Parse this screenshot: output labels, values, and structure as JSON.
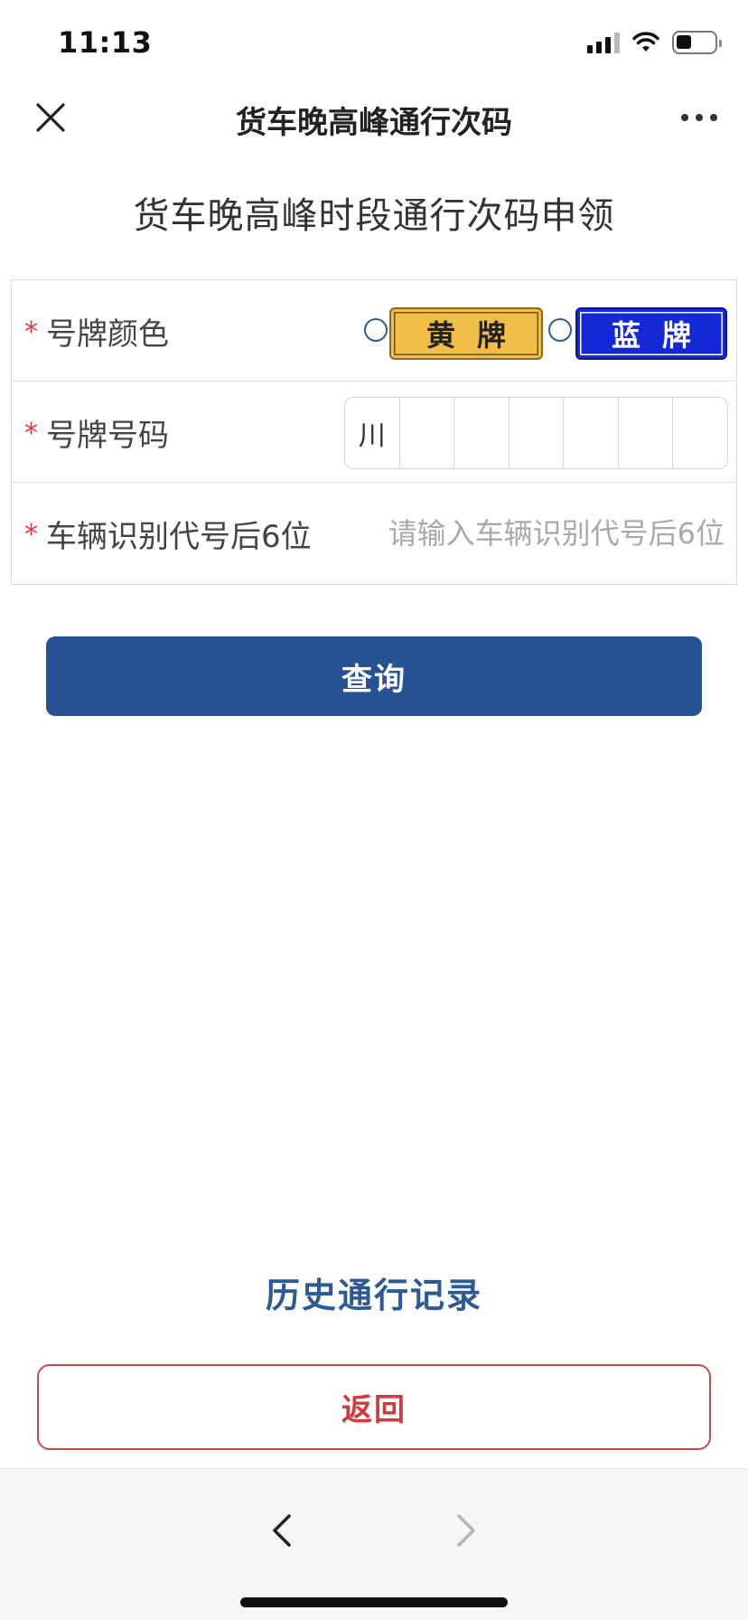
{
  "status_bar": {
    "time": "11:13"
  },
  "nav": {
    "title": "货车晚高峰通行次码",
    "close_icon": "close-icon",
    "more_icon": "more-icon"
  },
  "page": {
    "heading": "货车晚高峰时段通行次码申领"
  },
  "form": {
    "required_mark": "*",
    "plate_color": {
      "label": "号牌颜色",
      "options": [
        {
          "label": "黄牌",
          "color": "#f1bf47",
          "selected": false
        },
        {
          "label": "蓝牌",
          "color": "#1428d8",
          "selected": false
        }
      ]
    },
    "plate_number": {
      "label": "号牌号码",
      "chars": [
        "川",
        "",
        "",
        "",
        "",
        "",
        ""
      ]
    },
    "vin": {
      "label": "车辆识别代号后6位",
      "value": "",
      "placeholder": "请输入车辆识别代号后6位"
    }
  },
  "buttons": {
    "query": "查询",
    "history": "历史通行记录",
    "back": "返回"
  },
  "toolbar": {
    "back_icon": "chevron-left-icon",
    "forward_icon": "chevron-right-icon",
    "forward_enabled": false
  },
  "colors": {
    "primary": "#275293",
    "link": "#2d5a94",
    "danger": "#d33a3a",
    "required": "#d93a3a"
  }
}
